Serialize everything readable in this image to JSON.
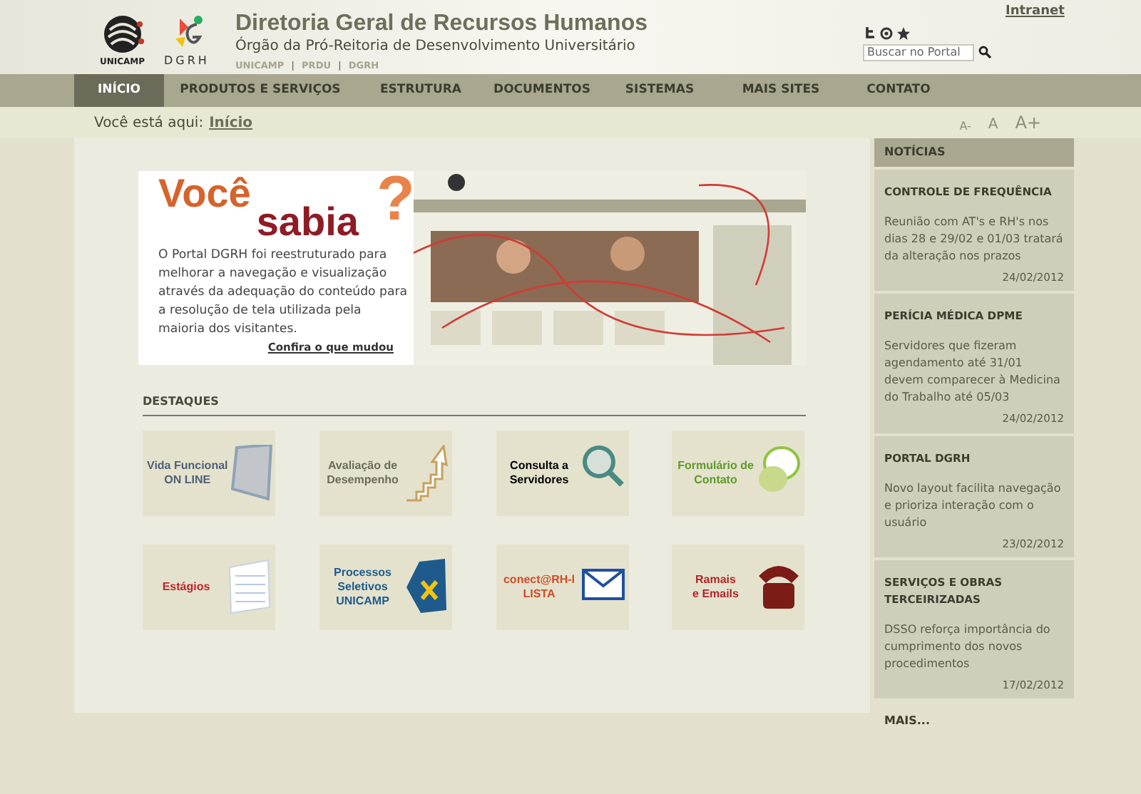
{
  "header": {
    "logos": [
      "UNICAMP",
      "DGRH"
    ],
    "title": "Diretoria Geral de Recursos Humanos",
    "subtitle": "Órgão da Pró-Reitoria de Desenvolvimento Universitário",
    "links": [
      "UNICAMP",
      "|",
      "PRDU",
      "|",
      "DGRH"
    ],
    "intranet": "Intranet",
    "search": {
      "placeholder": "Buscar no Portal"
    }
  },
  "nav": [
    {
      "label": "INÍCIO",
      "selected": true
    },
    {
      "label": "PRODUTOS E SERVIÇOS",
      "selected": false
    },
    {
      "label": "ESTRUTURA",
      "selected": false
    },
    {
      "label": "DOCUMENTOS",
      "selected": false
    },
    {
      "label": "SISTEMAS",
      "selected": false
    },
    {
      "label": "MAIS SITES",
      "selected": false
    },
    {
      "label": "CONTATO",
      "selected": false
    }
  ],
  "breadcrumb": {
    "label": "Você está aqui:",
    "current": "Início"
  },
  "font_sizes": [
    "A-",
    "A",
    "A+"
  ],
  "banner": {
    "title_1": "Você",
    "title_2": "sabia",
    "mark": "?",
    "text": "O Portal DGRH foi reestruturado para melhorar a navegação e visualização através da adequação do conteúdo para a resolução de tela utilizada pela maioria dos visitantes.",
    "link": "Confira o que mudou"
  },
  "highlights": {
    "title": "DESTAQUES",
    "tiles": [
      {
        "kind": "vida",
        "lines": [
          "Vida Funcional",
          "ON LINE"
        ]
      },
      {
        "kind": "avaliacao",
        "lines": [
          "Avaliação de",
          "Desempenho"
        ]
      },
      {
        "kind": "consulta",
        "lines": [
          "Consulta a",
          "Servidores"
        ]
      },
      {
        "kind": "formulario",
        "lines": [
          "Formulário de",
          "Contato"
        ]
      },
      {
        "kind": "estagios",
        "lines": [
          "Estágios"
        ]
      },
      {
        "kind": "processos",
        "lines": [
          "Processos",
          "Seletivos",
          "UNICAMP"
        ]
      },
      {
        "kind": "conecta",
        "lines": [
          "conect@RH-l",
          "LISTA"
        ]
      },
      {
        "kind": "ramais",
        "lines": [
          "Ramais",
          "e Emails"
        ]
      }
    ]
  },
  "news": {
    "title": "NOTÍCIAS",
    "items": [
      {
        "title": "CONTROLE DE FREQUÊNCIA",
        "text": "Reunião com AT's e RH's nos dias 28 e 29/02 e 01/03 tratará da alteração nos prazos",
        "date": "24/02/2012"
      },
      {
        "title": "PERÍCIA MÉDICA DPME",
        "text": "Servidores que fizeram agendamento até 31/01 devem comparecer à Medicina do Trabalho até 05/03",
        "date": "24/02/2012"
      },
      {
        "title": "PORTAL DGRH",
        "text": "Novo layout facilita navegação e prioriza interação com o usuário",
        "date": "23/02/2012"
      },
      {
        "title": "SERVIÇOS E OBRAS TERCEIRIZADAS",
        "text": "DSSO reforça importância do cumprimento dos novos procedimentos",
        "date": "17/02/2012"
      }
    ],
    "more": "MAIS..."
  }
}
